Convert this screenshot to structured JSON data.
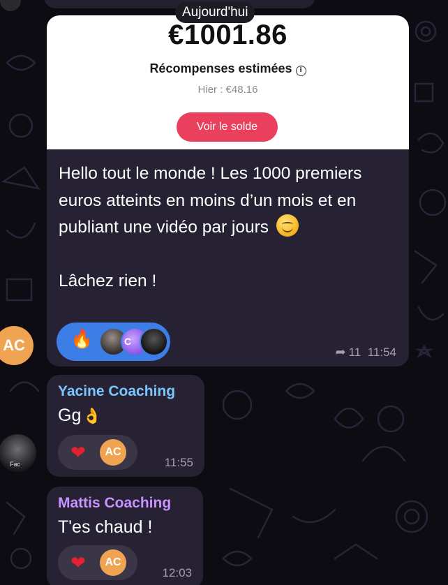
{
  "date_separator": "Aujourd'hui",
  "reward_card": {
    "amount": "€1001.86",
    "label": "Récompenses estimées",
    "yesterday": "Hier : €48.16",
    "button_label": "Voir le solde",
    "button_color": "#ea3f5d"
  },
  "main_message": {
    "text": "Hello tout le monde ! Les 1000 premiers euros atteints en moins d’un mois et en publiant une vidéo par jours",
    "text_line2": "Lâchez rien !",
    "emoji": "smiling-face-emoji",
    "reaction_emoji": "🔥",
    "reaction_avatar_label": "C",
    "reply_count": "11",
    "time": "11:54",
    "sender_avatar": "AC"
  },
  "messages": [
    {
      "sender": "Yacine Coaching",
      "sender_color": "#7cc6ff",
      "text": "Gg",
      "emoji": "👌",
      "reaction": "❤",
      "reaction_avatar": "AC",
      "time": "11:55",
      "avatar_label": "Fac"
    },
    {
      "sender": "Mattis Coaching",
      "sender_color": "#c792ff",
      "text": "T'es chaud !",
      "reaction": "❤",
      "reaction_avatar": "AC",
      "time": "12:03"
    }
  ],
  "colors": {
    "background": "#0c0c12",
    "bubble": "#262233",
    "reaction_blue": "#3d7ee6",
    "avatar_orange": "#f0a350"
  }
}
